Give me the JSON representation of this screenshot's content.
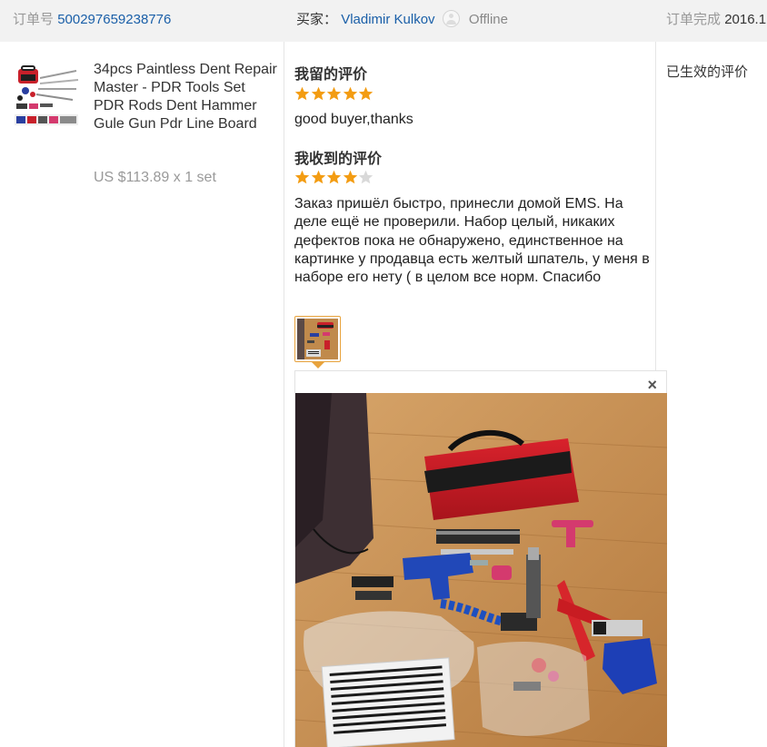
{
  "order": {
    "number_label": "订单号",
    "number": "500297659238776",
    "buyer_label": "买家：",
    "buyer_name": "Vladimir Kulkov",
    "buyer_status": "Offline",
    "completed_label": "订单完成",
    "completed_date": "2016.1"
  },
  "product": {
    "title": "34pcs Paintless Dent Repair Master - PDR Tools Set PDR Rods Dent Hammer Gule Gun Pdr Line Board",
    "price": "US $113.89 x 1 set",
    "thumb_icon": "product-thumbnail-image"
  },
  "my_review": {
    "heading": "我留的评价",
    "rating": 5,
    "text": "good buyer,thanks"
  },
  "received_review": {
    "heading": "我收到的评价",
    "rating": 4,
    "text": "Заказ пришёл быстро, принесли домой EMS. На деле ещё не проверили. Набор целый, никаких дефектов пока не обнаружено, единственное на картинке у продавца есть желтый шпатель, у меня в наборе его нету ( в целом все норм. Спасибо",
    "photo_count": 1
  },
  "viewer": {
    "close_label": "×",
    "close_icon": "close-icon"
  },
  "status": {
    "text": "已生效的评价"
  },
  "colors": {
    "star_on": "#f39c12",
    "star_off": "#d9d9d9",
    "link": "#1a5fa8",
    "thumb_border": "#e8a33d",
    "header_bg": "#f2f2f2"
  }
}
